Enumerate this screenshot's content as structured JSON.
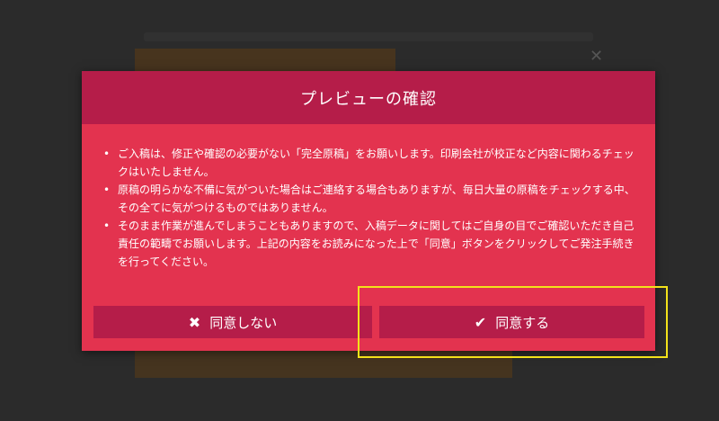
{
  "modal": {
    "title": "プレビューの確認",
    "notices": [
      "ご入稿は、修正や確認の必要がない「完全原稿」をお願いします。印刷会社が校正など内容に関わるチェックはいたしません。",
      "原稿の明らかな不備に気がついた場合はご連絡する場合もありますが、毎日大量の原稿をチェックする中、その全てに気がつけるものではありません。",
      "そのまま作業が進んでしまうこともありますので、入稿データに関してはご自身の目でご確認いただき自己責任の範疇でお願いします。上記の内容をお読みになった上で「同意」ボタンをクリックしてご発注手続きを行ってください。"
    ],
    "buttons": {
      "disagree_label": "同意しない",
      "disagree_icon": "close-icon",
      "agree_label": "同意する",
      "agree_icon": "check-icon"
    }
  },
  "colors": {
    "modal_body": "#e3334f",
    "modal_header": "#b51d49",
    "button": "#b51d49",
    "highlight": "#f3e21a",
    "overlay": "#2a2a2a"
  }
}
